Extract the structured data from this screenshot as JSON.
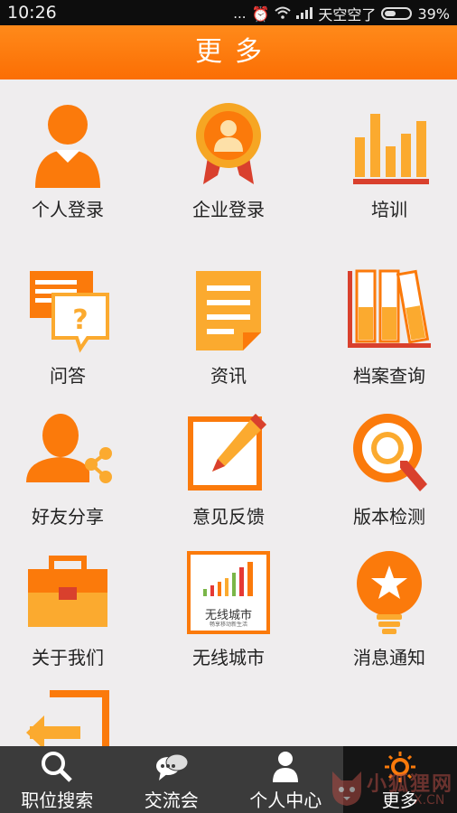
{
  "status_bar": {
    "time": "10:26",
    "dots": "...",
    "carrier": "天空空了",
    "battery": "39%"
  },
  "title_bar": {
    "title": "更多"
  },
  "grid": [
    {
      "label": "个人登录",
      "icon": "person-icon"
    },
    {
      "label": "企业登录",
      "icon": "award-badge-icon"
    },
    {
      "label": "培训",
      "icon": "bar-chart-icon"
    },
    {
      "label": "问答",
      "icon": "question-chat-icon"
    },
    {
      "label": "资讯",
      "icon": "document-icon"
    },
    {
      "label": "档案查询",
      "icon": "archive-books-icon"
    },
    {
      "label": "好友分享",
      "icon": "share-user-icon"
    },
    {
      "label": "意见反馈",
      "icon": "edit-pencil-icon"
    },
    {
      "label": "版本检测",
      "icon": "magnifier-icon"
    },
    {
      "label": "关于我们",
      "icon": "briefcase-icon"
    },
    {
      "label": "无线城市",
      "icon": "wireless-city-logo-icon"
    },
    {
      "label": "消息通知",
      "icon": "bulb-star-icon"
    },
    {
      "label": "",
      "icon": "logout-arrow-icon"
    }
  ],
  "city_logo": {
    "text": "无线城市",
    "subtext": "畅享移动新生活"
  },
  "tabs": [
    {
      "label": "职位搜索",
      "icon": "search-icon",
      "active": false
    },
    {
      "label": "交流会",
      "icon": "chat-bubbles-icon",
      "active": false
    },
    {
      "label": "个人中心",
      "icon": "user-icon",
      "active": false
    },
    {
      "label": "更多",
      "icon": "sun-gear-icon",
      "active": true
    }
  ],
  "watermark": {
    "text": "小狐狸网",
    "sub": "X.CN"
  },
  "colors": {
    "accent": "#fb7a0b",
    "orange_light": "#fbaa2f",
    "red": "#d9402d",
    "tab_bg": "#3b3b3b"
  }
}
